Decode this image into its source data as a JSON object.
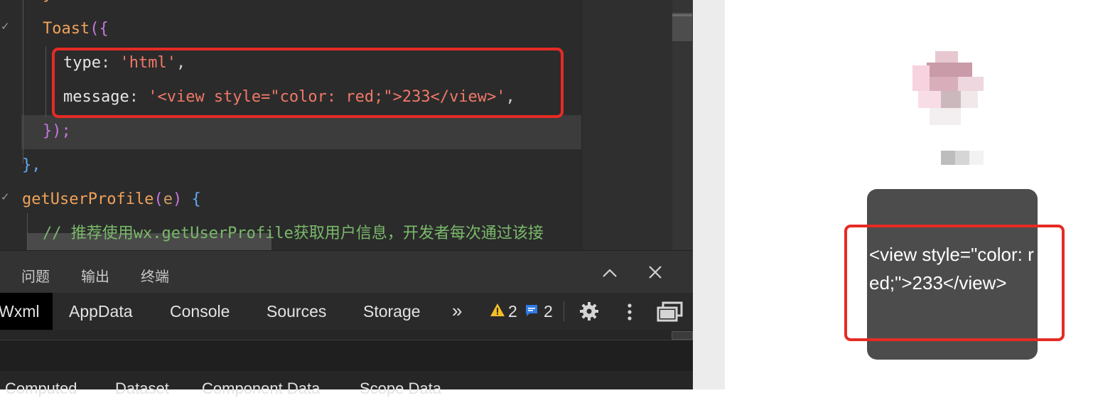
{
  "editor": {
    "code_lines": {
      "toast_fn": "Toast",
      "toast_open": "({",
      "type_key": "type",
      "type_val": "'html'",
      "message_key": "message",
      "message_val": "'<view style=\"color: red;\">233</view>'",
      "close_call": "});",
      "close_obj": "},",
      "method_name": "getUserProfile",
      "method_param": "e",
      "method_open": "{",
      "comment": "// 推荐使用wx.getUserProfile获取用户信息，开发者每次通过该接"
    }
  },
  "panel": {
    "tabs": [
      "问题",
      "输出",
      "终端"
    ],
    "collapse_icon": "chevron-up-icon",
    "close_icon": "close-icon"
  },
  "devtools": {
    "tabs": [
      "Wxml",
      "AppData",
      "Console",
      "Sources",
      "Storage"
    ],
    "active_tab": "Wxml",
    "more_label": "»",
    "warnings_count": "2",
    "messages_count": "2",
    "subtabs": [
      "Computed",
      "Dataset",
      "Component Data",
      "Scope Data"
    ]
  },
  "simulator": {
    "toast_message": "<view style=\"color: red;\">233</view>"
  },
  "colors": {
    "highlight_box": "#e52b24",
    "toast_bg": "#4c4c4c"
  }
}
